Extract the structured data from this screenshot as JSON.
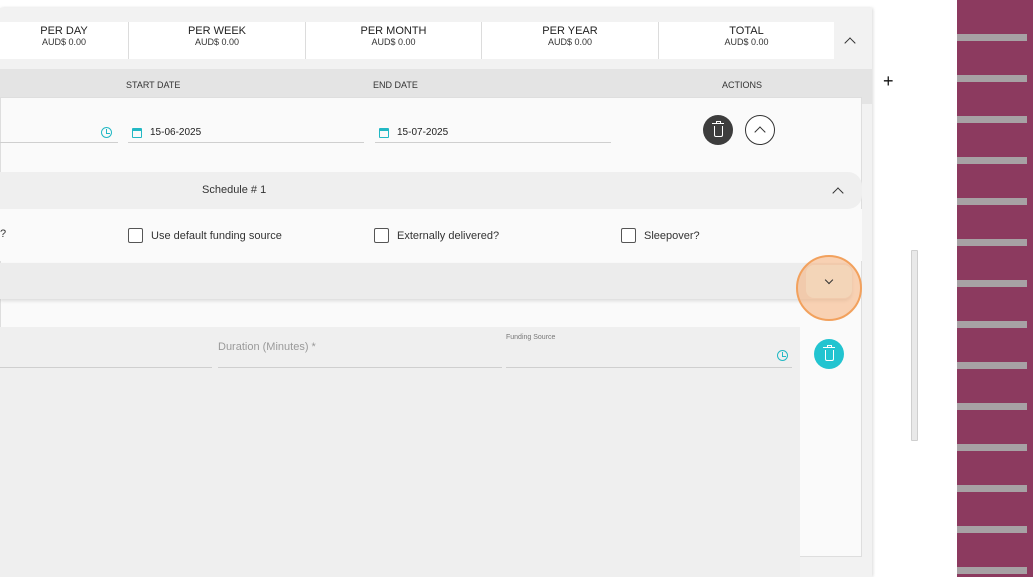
{
  "summary": [
    {
      "title": "PER DAY",
      "value": "AUD$ 0.00"
    },
    {
      "title": "PER WEEK",
      "value": "AUD$ 0.00"
    },
    {
      "title": "PER MONTH",
      "value": "AUD$ 0.00"
    },
    {
      "title": "PER YEAR",
      "value": "AUD$ 0.00"
    },
    {
      "title": "TOTAL",
      "value": "AUD$ 0.00"
    }
  ],
  "columns": {
    "start_date": "START DATE",
    "end_date": "END DATE",
    "actions": "ACTIONS"
  },
  "row": {
    "start_date": "15-06-2025",
    "end_date": "15-07-2025"
  },
  "schedule": {
    "title": "Schedule # 1",
    "truncated_question": "?",
    "checkboxes": [
      "Use default funding source",
      "Externally delivered?",
      "Sleepover?"
    ]
  },
  "item": {
    "duration_label": "Duration (Minutes) *",
    "funding_label": "Funding Source"
  },
  "misc": {
    "add_symbol": "+"
  },
  "colors": {
    "accent": "#22c4d0",
    "highlight": "#f2a15d",
    "wall": "#8c3a5f"
  }
}
